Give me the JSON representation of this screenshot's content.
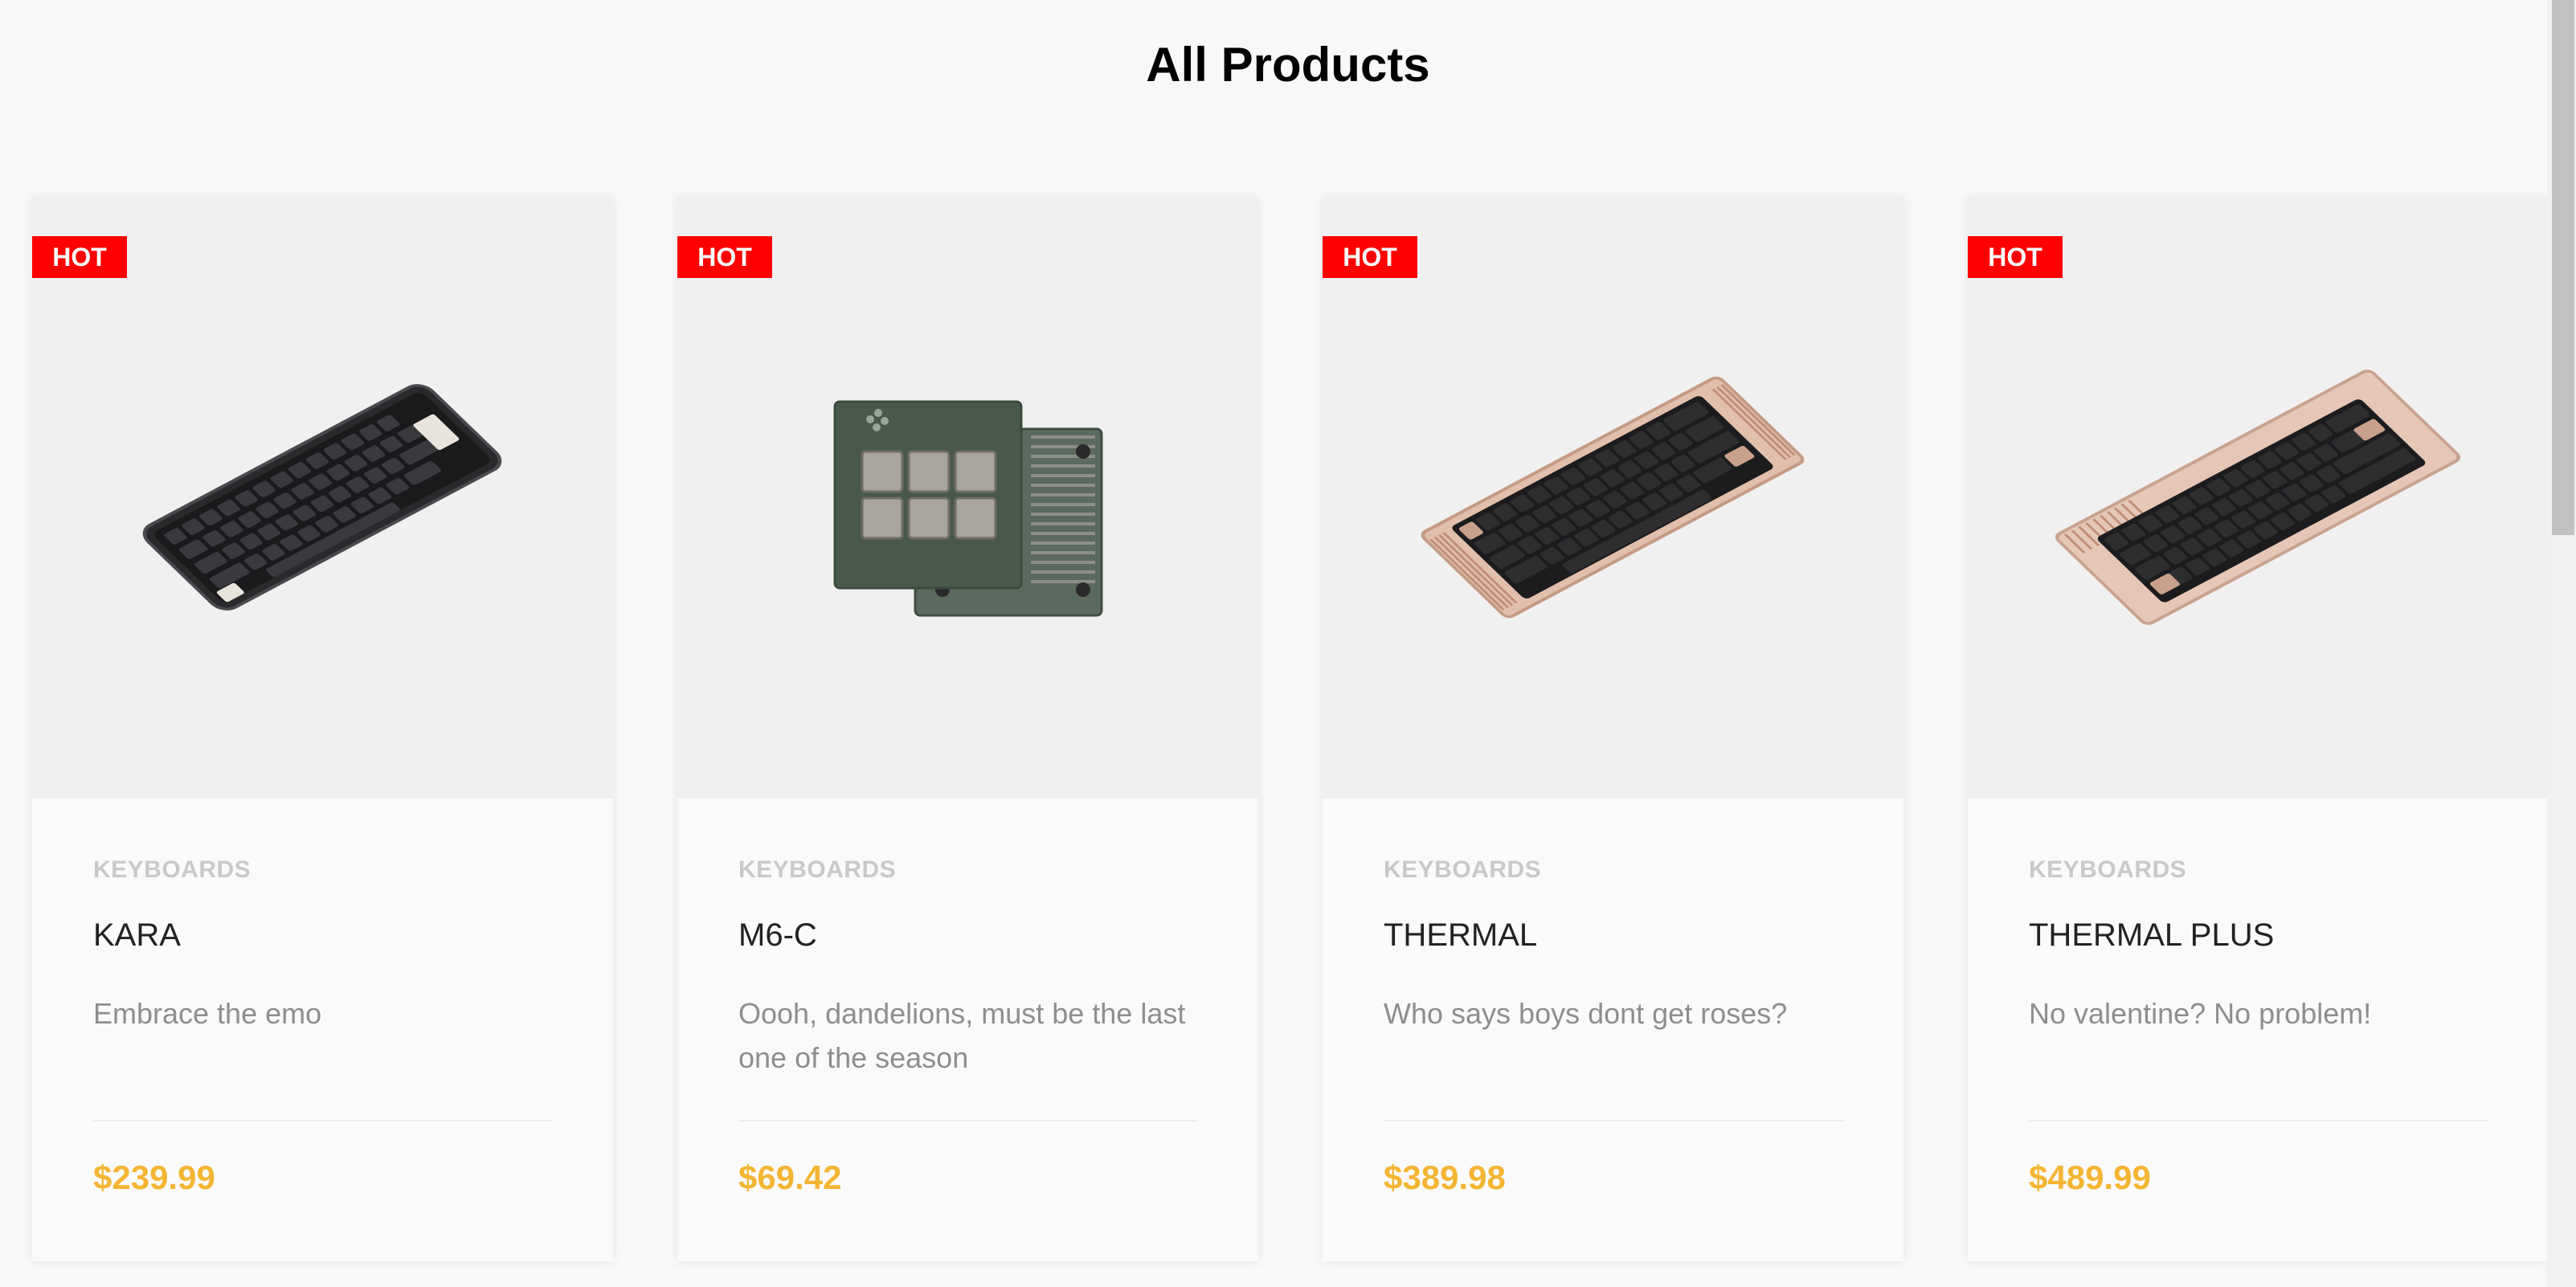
{
  "page": {
    "title": "All Products"
  },
  "colors": {
    "badge": "#fe0000",
    "price": "#f4b533",
    "category": "#c9c9c9"
  },
  "products": [
    {
      "badge": "HOT",
      "category": "KEYBOARDS",
      "name": "KARA",
      "description": "Embrace the emo",
      "price": "$239.99",
      "image_icon": "black-keyboard-image"
    },
    {
      "badge": "HOT",
      "category": "KEYBOARDS",
      "name": "M6-C",
      "description": "Oooh, dandelions, must be the last one of the season",
      "price": "$69.42",
      "image_icon": "macropad-image"
    },
    {
      "badge": "HOT",
      "category": "KEYBOARDS",
      "name": "THERMAL",
      "description": "Who says boys dont get roses?",
      "price": "$389.98",
      "image_icon": "rose-gold-keyboard-image"
    },
    {
      "badge": "HOT",
      "category": "KEYBOARDS",
      "name": "THERMAL PLUS",
      "description": "No valentine? No problem!",
      "price": "$489.99",
      "image_icon": "rose-gold-keyboard-plus-image"
    }
  ]
}
